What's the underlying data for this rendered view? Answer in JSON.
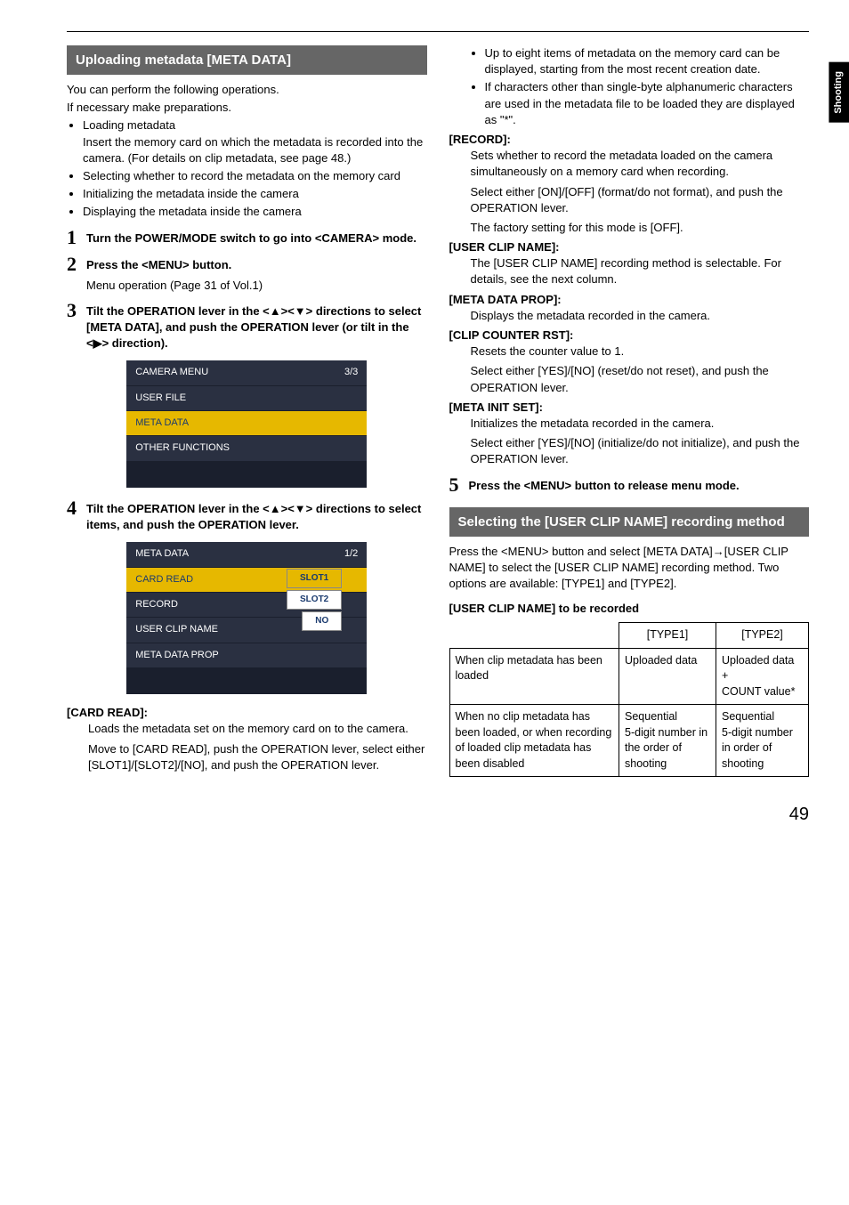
{
  "sideTab": "Shooting",
  "pageNumber": "49",
  "left": {
    "header1": "Uploading metadata [META DATA]",
    "intro1": "You can perform the following operations.",
    "intro2": "If necessary make preparations.",
    "bullets": [
      {
        "head": "Loading metadata",
        "body": "Insert the memory card on which the metadata is recorded into the camera. (For details on clip metadata, see page 48.)"
      },
      {
        "head": "Selecting whether to record the metadata on the memory card",
        "body": ""
      },
      {
        "head": "Initializing the metadata inside the camera",
        "body": ""
      },
      {
        "head": "Displaying the metadata inside the camera",
        "body": ""
      }
    ],
    "step1": "Turn the POWER/MODE switch to go into <CAMERA> mode.",
    "step2": "Press the <MENU> button.",
    "step2body": "Menu operation (Page 31 of Vol.1)",
    "step3": "Tilt the OPERATION lever in the <▲><▼> directions to select [META DATA], and push the OPERATION lever (or tilt in the <▶> direction).",
    "shot1": {
      "title": "CAMERA MENU",
      "page": "3/3",
      "rows": [
        "USER FILE",
        "META DATA",
        "OTHER FUNCTIONS"
      ],
      "hi": 1
    },
    "step4": "Tilt the OPERATION lever in the <▲><▼> directions to select items, and push the OPERATION lever.",
    "shot2": {
      "title": "META DATA",
      "page": "1/2",
      "rows": [
        {
          "l": "CARD READ",
          "pop": [
            "SLOT1",
            "SLOT2",
            "NO"
          ],
          "hi": true
        },
        {
          "l": "RECORD"
        },
        {
          "l": "USER CLIP NAME"
        },
        {
          "l": "META DATA PROP"
        }
      ]
    },
    "cardRead": {
      "label": "[CARD READ]:",
      "b1": "Loads the metadata set on the memory card on to the camera.",
      "b2": "Move to [CARD READ], push the OPERATION lever, select either [SLOT1]/[SLOT2]/[NO], and push the OPERATION lever."
    }
  },
  "right": {
    "topBullets": [
      "Up to eight items of metadata on the memory card can be displayed, starting from the most recent creation date.",
      "If characters other than single-byte alphanumeric characters are used in the metadata file to be loaded they are displayed as \"*\"."
    ],
    "record": {
      "label": "[RECORD]:",
      "b1": "Sets whether to record the metadata loaded on the camera simultaneously on a memory card when recording.",
      "b2": "Select either [ON]/[OFF] (format/do not format), and push the OPERATION lever.",
      "b3": "The factory setting for this mode is [OFF]."
    },
    "ucn": {
      "label": "[USER CLIP NAME]:",
      "b1": "The [USER CLIP NAME] recording method is selectable. For details, see the next column."
    },
    "mdp": {
      "label": "[META DATA PROP]:",
      "b1": "Displays the metadata recorded in the camera."
    },
    "ccr": {
      "label": "[CLIP COUNTER RST]:",
      "b1": "Resets the counter value to 1.",
      "b2": "Select either [YES]/[NO] (reset/do not reset), and push the OPERATION lever."
    },
    "mis": {
      "label": "[META INIT SET]:",
      "b1": "Initializes the metadata recorded in the camera.",
      "b2": "Select either [YES]/[NO] (initialize/do not initialize), and push the OPERATION lever."
    },
    "step5": "Press the <MENU> button to release menu mode.",
    "header2": "Selecting the [USER CLIP NAME] recording method",
    "sec2p": "Press the <MENU> button and select [META DATA]→[USER CLIP NAME] to select the [USER CLIP NAME] recording method. Two options are available: [TYPE1] and [TYPE2].",
    "tableCaption": "[USER CLIP NAME] to be recorded",
    "table": {
      "head": [
        "",
        "[TYPE1]",
        "[TYPE2]"
      ],
      "rows": [
        [
          "When clip metadata has been loaded",
          "Uploaded data",
          "Uploaded data\n+\nCOUNT value*"
        ],
        [
          "When no clip metadata has been loaded, or when recording of loaded clip metadata has been disabled",
          "Sequential\n5-digit number in the order of shooting",
          "Sequential\n5-digit number in order of shooting"
        ]
      ]
    }
  }
}
